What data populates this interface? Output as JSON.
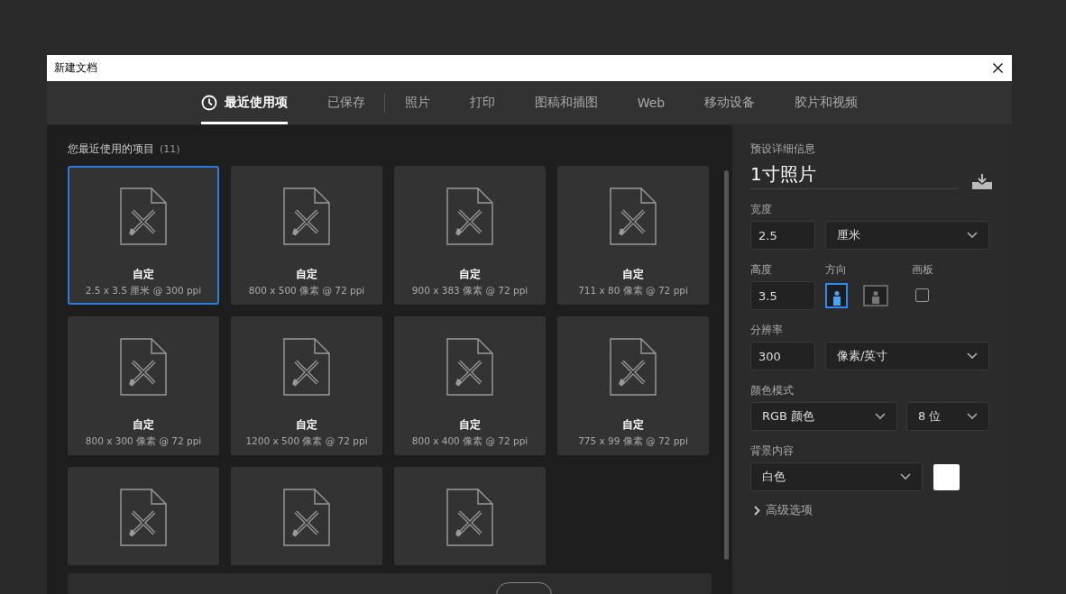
{
  "window": {
    "title": "新建文档"
  },
  "tabs": [
    {
      "label": "最近使用项",
      "selected": true,
      "has_icon": true,
      "separator_after": false
    },
    {
      "label": "已保存",
      "selected": false,
      "has_icon": false,
      "separator_after": true
    },
    {
      "label": "照片",
      "selected": false,
      "has_icon": false,
      "separator_after": false
    },
    {
      "label": "打印",
      "selected": false,
      "has_icon": false,
      "separator_after": false
    },
    {
      "label": "图稿和插图",
      "selected": false,
      "has_icon": false,
      "separator_after": false
    },
    {
      "label": "Web",
      "selected": false,
      "has_icon": false,
      "separator_after": false
    },
    {
      "label": "移动设备",
      "selected": false,
      "has_icon": false,
      "separator_after": false
    },
    {
      "label": "胶片和视频",
      "selected": false,
      "has_icon": false,
      "separator_after": false
    }
  ],
  "recent": {
    "heading": "您最近使用的项目",
    "count": "(11)",
    "items": [
      {
        "name": "自定",
        "size": "2.5 x 3.5 厘米 @ 300 ppi",
        "selected": true
      },
      {
        "name": "自定",
        "size": "800 x 500 像素 @ 72 ppi",
        "selected": false
      },
      {
        "name": "自定",
        "size": "900 x 383 像素 @ 72 ppi",
        "selected": false
      },
      {
        "name": "自定",
        "size": "711 x 80 像素 @ 72 ppi",
        "selected": false
      },
      {
        "name": "自定",
        "size": "800 x 300 像素 @ 72 ppi",
        "selected": false
      },
      {
        "name": "自定",
        "size": "1200 x 500 像素 @ 72 ppi",
        "selected": false
      },
      {
        "name": "自定",
        "size": "800 x 400 像素 @ 72 ppi",
        "selected": false
      },
      {
        "name": "自定",
        "size": "775 x 99 像素 @ 72 ppi",
        "selected": false
      },
      {
        "selected": false
      },
      {
        "selected": false
      },
      {
        "selected": false
      }
    ]
  },
  "details": {
    "heading": "预设详细信息",
    "preset_name": "1寸照片",
    "width": {
      "label": "宽度",
      "value": "2.5",
      "unit": "厘米"
    },
    "height": {
      "label": "高度",
      "value": "3.5"
    },
    "orientation": {
      "label": "方向",
      "options": [
        {
          "selected": true
        },
        {
          "selected": false
        }
      ]
    },
    "artboard": {
      "label": "画板",
      "checked": false
    },
    "resolution": {
      "label": "分辨率",
      "value": "300",
      "unit": "像素/英寸"
    },
    "color_mode": {
      "label": "颜色模式",
      "mode": "RGB 颜色",
      "depth": "8 位"
    },
    "background": {
      "label": "背景内容",
      "value": "白色",
      "color": "#ffffff"
    },
    "advanced": {
      "label": "高级选项",
      "expanded": false
    }
  }
}
